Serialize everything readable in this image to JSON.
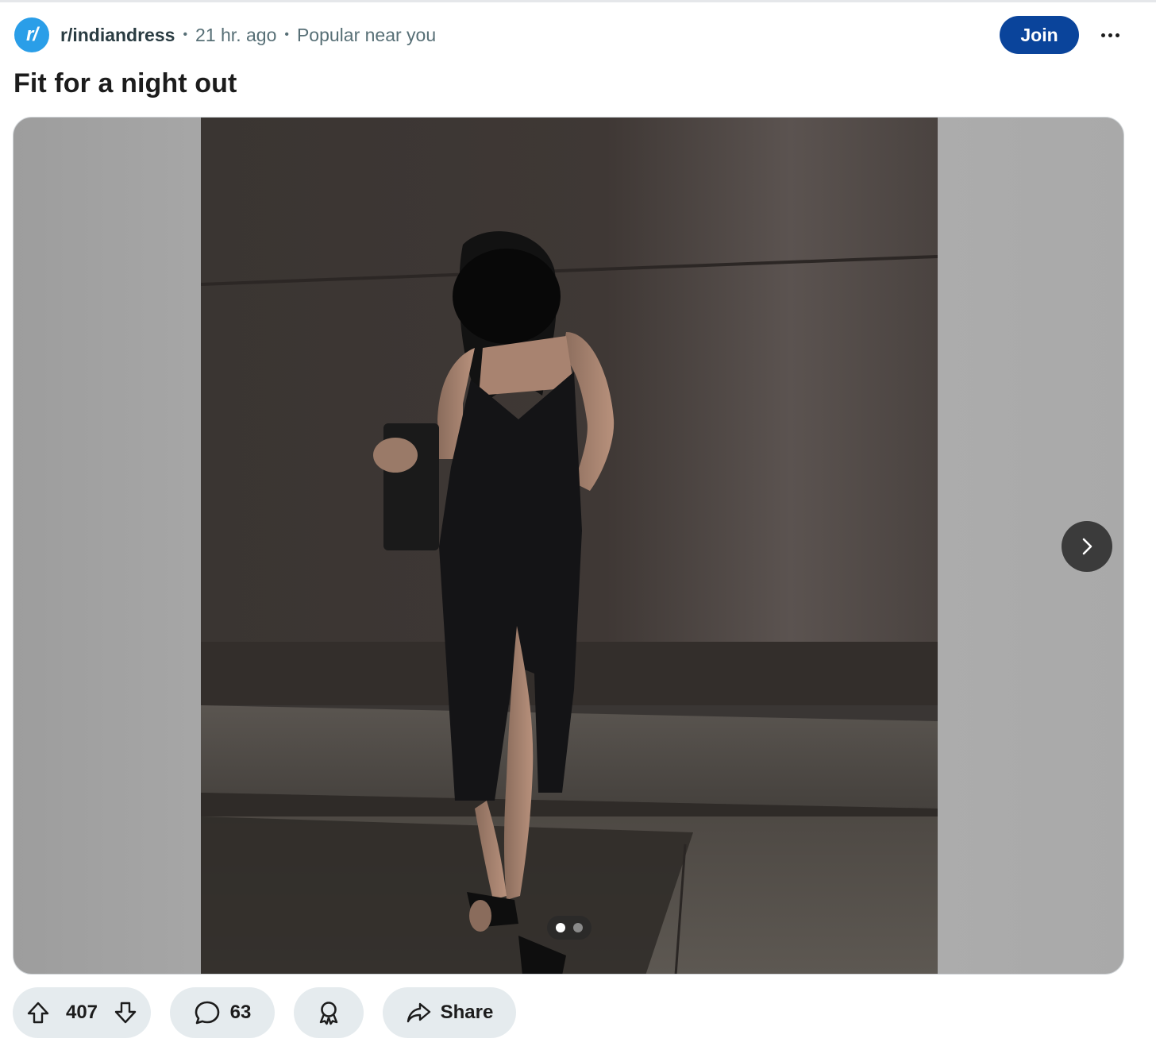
{
  "post": {
    "subreddit_icon": "r/",
    "subreddit": "r/indiandress",
    "time": "21 hr. ago",
    "context": "Popular near you",
    "join_label": "Join",
    "title": "Fit for a night out",
    "gallery": {
      "current_page": 1,
      "total_pages": 2
    },
    "votes": "407",
    "comments": "63",
    "share_label": "Share"
  },
  "colors": {
    "join_button": "#0a449b",
    "subreddit_icon": "#2a9ee8",
    "action_pill": "#e5ebee"
  },
  "icons": [
    "more-options-icon",
    "chevron-right-icon",
    "upvote-icon",
    "downvote-icon",
    "comment-icon",
    "award-icon",
    "share-icon"
  ]
}
